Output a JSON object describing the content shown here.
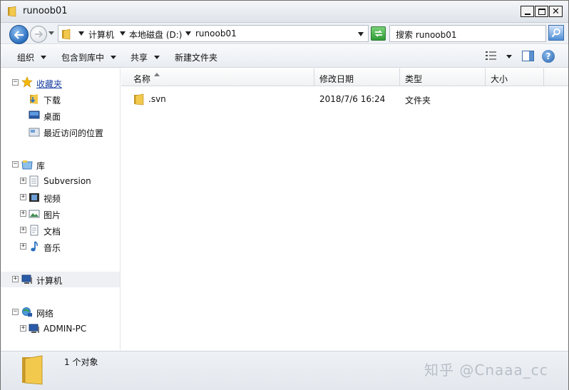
{
  "window": {
    "title": "runoob01"
  },
  "nav": {
    "breadcrumbs": [
      "计算机",
      "本地磁盘 (D:)",
      "runoob01"
    ],
    "search_placeholder": "搜索 runoob01"
  },
  "toolbar": {
    "organize": "组织",
    "include_in_library": "包含到库中",
    "share": "共享",
    "new_folder": "新建文件夹"
  },
  "sidebar": {
    "favorites": {
      "label": "收藏夹",
      "items": [
        "下载",
        "桌面",
        "最近访问的位置"
      ]
    },
    "libraries": {
      "label": "库",
      "items": [
        "Subversion",
        "视频",
        "图片",
        "文档",
        "音乐"
      ]
    },
    "computer": {
      "label": "计算机"
    },
    "network": {
      "label": "网络",
      "items": [
        "ADMIN-PC"
      ]
    }
  },
  "columns": [
    "名称",
    "修改日期",
    "类型",
    "大小"
  ],
  "files": [
    {
      "name": ".svn",
      "modified": "2018/7/6 16:24",
      "type": "文件夹",
      "size": ""
    }
  ],
  "status": {
    "text": "1 个对象"
  },
  "watermark": "知乎 @Cnaaa_cc",
  "colors": {
    "folder": "#f2c94c",
    "accent": "#2a6fbf"
  }
}
